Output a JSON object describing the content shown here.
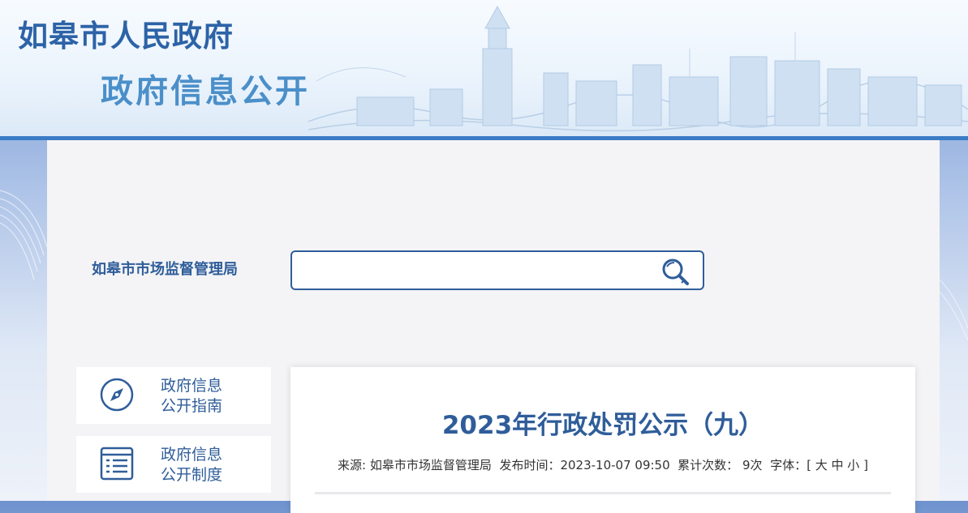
{
  "header": {
    "title": "如皋市人民政府",
    "subtitle": "政府信息公开"
  },
  "search": {
    "department": "如皋市市场监督管理局",
    "value": "",
    "placeholder": ""
  },
  "nav": [
    {
      "line1": "政府信息",
      "line2": "公开指南",
      "icon": "compass-icon"
    },
    {
      "line1": "政府信息",
      "line2": "公开制度",
      "icon": "document-list-icon"
    }
  ],
  "article": {
    "title": "2023年行政处罚公示（九）",
    "source_label": "来源:",
    "source": "如皋市市场监督管理局",
    "publish_label": "发布时间：",
    "publish_time": "2023-10-07 09:50",
    "views_label": "累计次数：",
    "views": "9次",
    "font_label": "字体：[",
    "font_large": "大",
    "font_medium": "中",
    "font_small": "小",
    "font_close": "]"
  },
  "colors": {
    "brand": "#2f5d9a",
    "header_line": "#3a7bc6",
    "panel_bg": "#f4f4f6"
  }
}
